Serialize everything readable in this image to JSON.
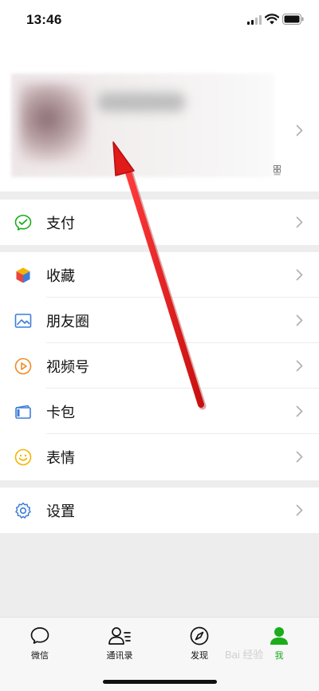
{
  "status_bar": {
    "time": "13:46"
  },
  "profile": {
    "chevron_icon": "chevron-right-icon",
    "qr_icon": "qr-code-icon"
  },
  "menu": {
    "pay": {
      "label": "支付",
      "icon": "pay-icon",
      "color": "#1aad19"
    },
    "favorites": {
      "label": "收藏",
      "icon": "favorites-cube-icon"
    },
    "moments": {
      "label": "朋友圈",
      "icon": "moments-image-icon",
      "color": "#3d7dd8"
    },
    "channels": {
      "label": "视频号",
      "icon": "channels-play-icon",
      "color": "#f08a24"
    },
    "card_pack": {
      "label": "卡包",
      "icon": "card-wallet-icon",
      "color": "#3d7dd8"
    },
    "stickers": {
      "label": "表情",
      "icon": "sticker-smile-icon",
      "color": "#f4b400"
    },
    "settings": {
      "label": "设置",
      "icon": "settings-gear-icon",
      "color": "#3d7dd8"
    }
  },
  "tab_bar": {
    "chats": "微信",
    "contacts": "通讯录",
    "discover": "发现",
    "me": "我",
    "active_color": "#1aad19"
  },
  "watermark": "Bai 经验",
  "annotation": {
    "arrow_color": "#e11a1a"
  }
}
